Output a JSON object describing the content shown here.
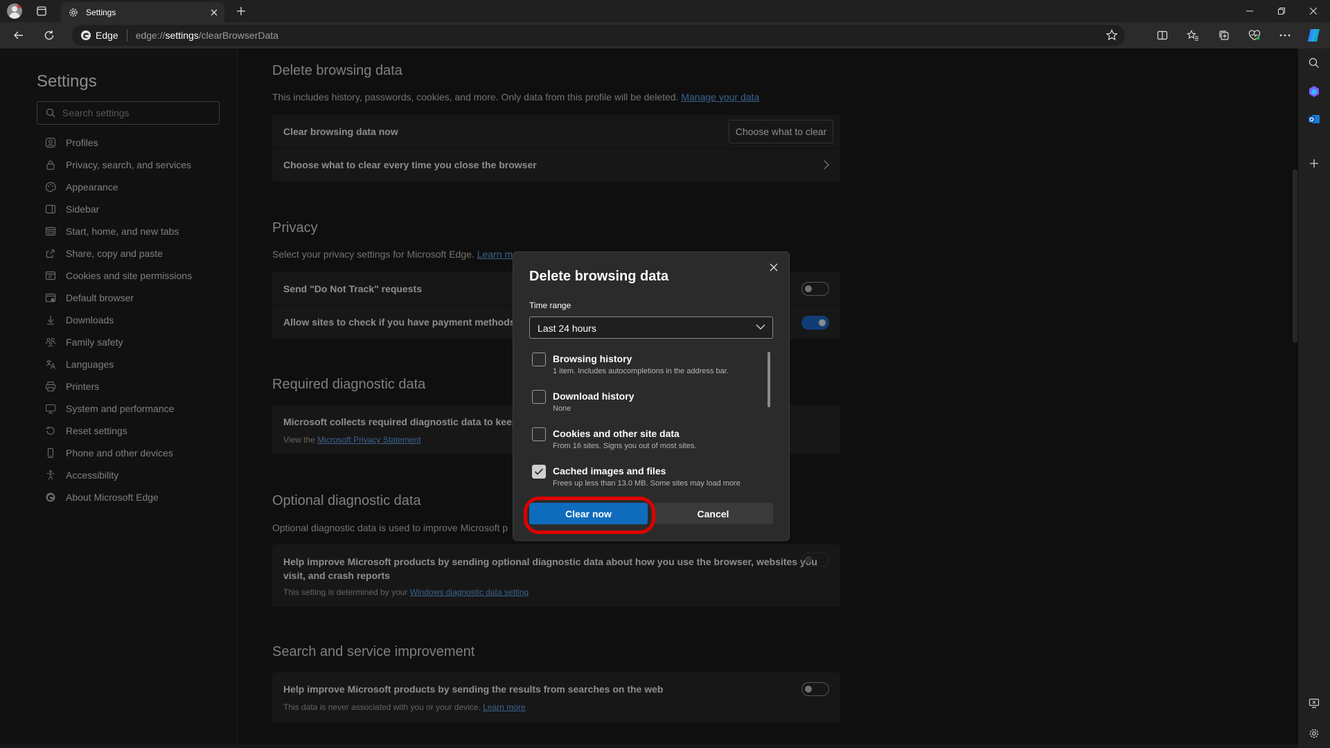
{
  "browser": {
    "tab_title": "Settings",
    "omnibox_brand": "Edge",
    "url_prefix": "edge://",
    "url_host": "settings",
    "url_path": "/clearBrowserData"
  },
  "sidebar": {
    "title": "Settings",
    "search_placeholder": "Search settings",
    "items": [
      {
        "label": "Profiles",
        "icon": "profile-icon"
      },
      {
        "label": "Privacy, search, and services",
        "icon": "lock-icon"
      },
      {
        "label": "Appearance",
        "icon": "appearance-icon"
      },
      {
        "label": "Sidebar",
        "icon": "sidebar-icon"
      },
      {
        "label": "Start, home, and new tabs",
        "icon": "home-icon"
      },
      {
        "label": "Share, copy and paste",
        "icon": "share-icon"
      },
      {
        "label": "Cookies and site permissions",
        "icon": "cookie-icon"
      },
      {
        "label": "Default browser",
        "icon": "browser-icon"
      },
      {
        "label": "Downloads",
        "icon": "download-icon"
      },
      {
        "label": "Family safety",
        "icon": "family-icon"
      },
      {
        "label": "Languages",
        "icon": "language-icon"
      },
      {
        "label": "Printers",
        "icon": "printer-icon"
      },
      {
        "label": "System and performance",
        "icon": "system-icon"
      },
      {
        "label": "Reset settings",
        "icon": "reset-icon"
      },
      {
        "label": "Phone and other devices",
        "icon": "phone-icon"
      },
      {
        "label": "Accessibility",
        "icon": "accessibility-icon"
      },
      {
        "label": "About Microsoft Edge",
        "icon": "edge-icon"
      }
    ]
  },
  "delete_section": {
    "title": "Delete browsing data",
    "desc": "This includes history, passwords, cookies, and more. Only data from this profile will be deleted.",
    "desc_link": "Manage your data",
    "row1_title": "Clear browsing data now",
    "row1_button": "Choose what to clear",
    "row2_title": "Choose what to clear every time you close the browser"
  },
  "privacy_section": {
    "title": "Privacy",
    "desc": "Select your privacy settings for Microsoft Edge.",
    "desc_link": "Learn mo",
    "row1_title": "Send \"Do Not Track\" requests",
    "row1_toggle": false,
    "row2_title": "Allow sites to check if you have payment methods s",
    "row2_toggle": true
  },
  "required_section": {
    "title": "Required diagnostic data",
    "row_title": "Microsoft collects required diagnostic data to keep M",
    "row_sub": "View the",
    "row_sub_link": "Microsoft Privacy Statement"
  },
  "optional_section": {
    "title": "Optional diagnostic data",
    "desc": "Optional diagnostic data is used to improve Microsoft p",
    "row_title_1": "Help improve Microsoft products by sending optional diagnostic data about how you use the browser, websites you",
    "row_title_2": "visit, and crash reports",
    "row_sub": "This setting is determined by your",
    "row_sub_link": "Windows diagnostic data setting",
    "toggle": false
  },
  "search_section": {
    "title": "Search and service improvement",
    "row_title": "Help improve Microsoft products by sending the results from searches on the web",
    "row_sub": "This data is never associated with you or your device.",
    "row_sub_link": "Learn more",
    "toggle": false
  },
  "dialog": {
    "title": "Delete browsing data",
    "time_range_label": "Time range",
    "time_range_value": "Last 24 hours",
    "options": [
      {
        "title": "Browsing history",
        "sub": "1 item. Includes autocompletions in the address bar.",
        "checked": false
      },
      {
        "title": "Download history",
        "sub": "None",
        "checked": false
      },
      {
        "title": "Cookies and other site data",
        "sub": "From 16 sites. Signs you out of most sites.",
        "checked": false
      },
      {
        "title": "Cached images and files",
        "sub": "Frees up less than 13.0 MB. Some sites may load more",
        "checked": true
      }
    ],
    "primary_button": "Clear now",
    "secondary_button": "Cancel"
  },
  "colors": {
    "accent": "#0f6cbd",
    "highlight_ring": "#e00000",
    "link": "#6cb4ff"
  }
}
